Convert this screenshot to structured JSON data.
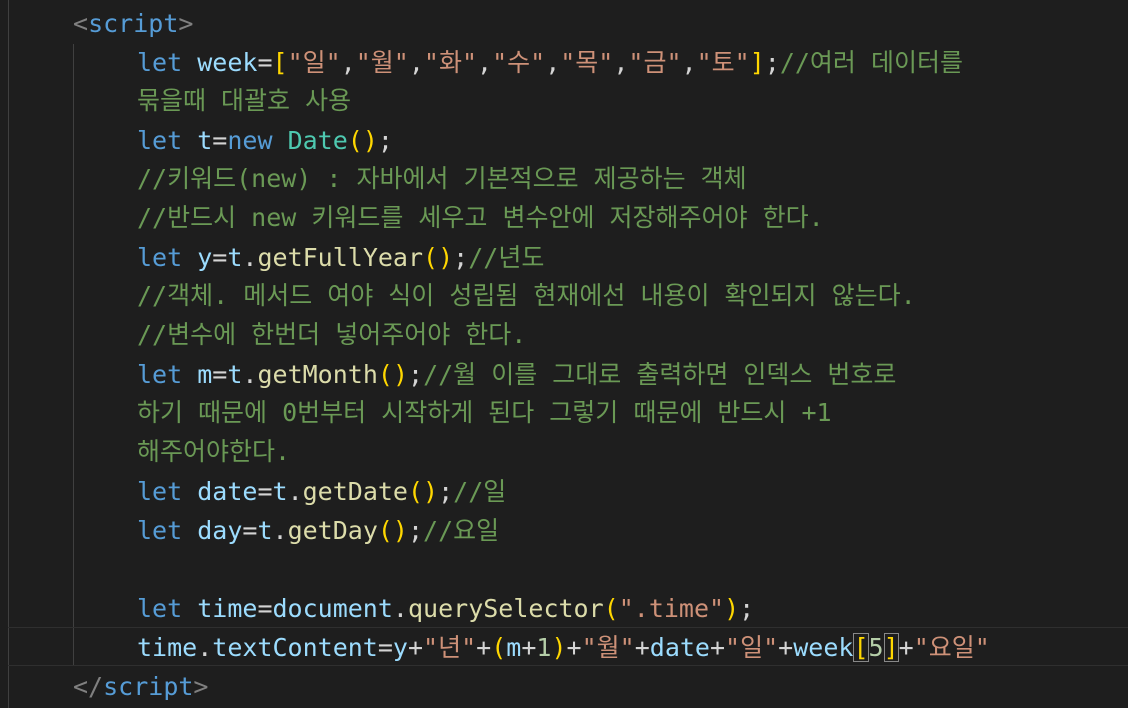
{
  "editor": {
    "language": "javascript",
    "lines": {
      "l1_open_tag": "script",
      "l2_kw": "let",
      "l2_var": "week",
      "l2_eq": "=",
      "l2_open": "[",
      "l2_s1": "\"일\"",
      "l2_s2": "\"월\"",
      "l2_s3": "\"화\"",
      "l2_s4": "\"수\"",
      "l2_s5": "\"목\"",
      "l2_s6": "\"금\"",
      "l2_s7": "\"토\"",
      "l2_close": "]",
      "l2_semi": ";",
      "l2_comment": "//여러 데이터를",
      "l3_comment": "묶을때 대괄호 사용",
      "l4_kw": "let",
      "l4_var": "t",
      "l4_eq": "=",
      "l4_new": "new",
      "l4_cls": "Date",
      "l4_parens": "()",
      "l4_semi": ";",
      "l5_comment": "//키워드(new) : 자바에서 기본적으로 제공하는 객체",
      "l6_comment": "//반드시 new 키워드를 세우고 변수안에 저장해주어야 한다.",
      "l7_kw": "let",
      "l7_var": "y",
      "l7_eq": "=",
      "l7_obj": "t",
      "l7_dot": ".",
      "l7_fn": "getFullYear",
      "l7_parens": "()",
      "l7_semi": ";",
      "l7_comment": "//년도",
      "l8_comment": "//객체. 메서드 여야 식이 성립됨 현재에선 내용이 확인되지 않는다.",
      "l9_comment": "//변수에 한번더 넣어주어야 한다.",
      "l10_kw": "let",
      "l10_var": "m",
      "l10_eq": "=",
      "l10_obj": "t",
      "l10_dot": ".",
      "l10_fn": "getMonth",
      "l10_parens": "()",
      "l10_semi": ";",
      "l10_comment": "//월 이를 그대로 출력하면 인덱스 번호로",
      "l11_comment": "하기 때문에 0번부터 시작하게 된다 그렇기 때문에 반드시 +1",
      "l12_comment": "해주어야한다.",
      "l13_kw": "let",
      "l13_var": "date",
      "l13_eq": "=",
      "l13_obj": "t",
      "l13_dot": ".",
      "l13_fn": "getDate",
      "l13_parens": "()",
      "l13_semi": ";",
      "l13_comment": "//일",
      "l14_kw": "let",
      "l14_var": "day",
      "l14_eq": "=",
      "l14_obj": "t",
      "l14_dot": ".",
      "l14_fn": "getDay",
      "l14_parens": "()",
      "l14_semi": ";",
      "l14_comment": "//요일",
      "l16_kw": "let",
      "l16_var": "time",
      "l16_eq": "=",
      "l16_obj": "document",
      "l16_dot": ".",
      "l16_fn": "querySelector",
      "l16_po": "(",
      "l16_str": "\".time\"",
      "l16_pc": ")",
      "l16_semi": ";",
      "l17_obj": "time",
      "l17_dot": ".",
      "l17_prop": "textContent",
      "l17_eq": "=",
      "l17_y": "y",
      "l17_plus1": "+",
      "l17_s1": "\"년\"",
      "l17_plus2": "+",
      "l17_po": "(",
      "l17_m": "m",
      "l17_plus3": "+",
      "l17_one": "1",
      "l17_pc": ")",
      "l17_plus4": "+",
      "l17_s2": "\"월\"",
      "l17_plus5": "+",
      "l17_date": "date",
      "l17_plus6": "+",
      "l17_s3": "\"일\"",
      "l17_plus7": "+",
      "l17_week": "week",
      "l17_bo": "[",
      "l17_five": "5",
      "l17_bc": "]",
      "l17_plus8": "+",
      "l17_s4": "\"요일\"",
      "l18_close_tag": "script"
    }
  },
  "colors": {
    "background": "#1e1e1e",
    "keyword": "#569cd6",
    "variable": "#9cdcfe",
    "function": "#dcdcaa",
    "class": "#4ec9b0",
    "string": "#ce9178",
    "number": "#b5cea8",
    "comment": "#6a9955",
    "bracket_level1": "#ffd700",
    "bracket_level2": "#da70d6"
  }
}
